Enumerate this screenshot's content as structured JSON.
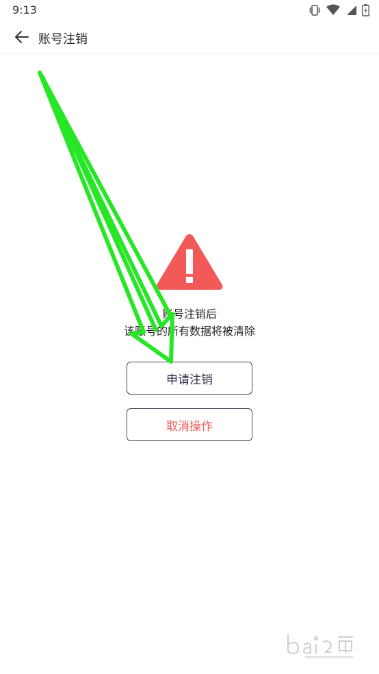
{
  "status_bar": {
    "time": "9:13",
    "icons": [
      "vibrate-icon",
      "wifi-icon",
      "signal-icon",
      "battery-icon"
    ]
  },
  "app_bar": {
    "title": "账号注销",
    "back_icon": "back-arrow-icon"
  },
  "content": {
    "icon": "warning-triangle-icon",
    "message_line1": "账号注销后",
    "message_line2": "该账号的所有数据将被清除"
  },
  "buttons": {
    "apply_label": "申请注销",
    "cancel_label": "取消操作"
  },
  "colors": {
    "warning": "#f25a5a",
    "button_border": "#3f4257",
    "apply_text": "#2b2e45",
    "cancel_text": "#f25a5a",
    "annotation": "#26e626"
  }
}
